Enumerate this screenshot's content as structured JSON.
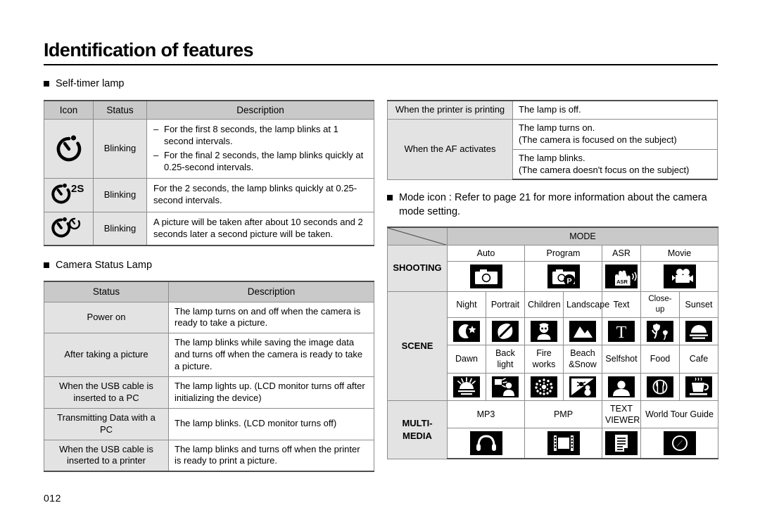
{
  "page": {
    "title": "Identification of features",
    "number": "012"
  },
  "self_timer": {
    "heading": "Self-timer lamp",
    "columns": [
      "Icon",
      "Status",
      "Description"
    ],
    "rows": [
      {
        "icon": "self-timer-10s-icon",
        "status": "Blinking",
        "description_items": [
          "For the first 8 seconds, the lamp blinks at 1 second intervals.",
          "For the final 2 seconds, the lamp blinks quickly at 0.25-second intervals."
        ]
      },
      {
        "icon": "self-timer-2s-icon",
        "icon_sup": "2S",
        "status": "Blinking",
        "description": "For the 2 seconds, the lamp blinks quickly at 0.25-second intervals."
      },
      {
        "icon": "self-timer-double-icon",
        "status": "Blinking",
        "description": "A picture will be taken after about 10 seconds and 2 seconds later a second picture will be taken."
      }
    ]
  },
  "status_lamp": {
    "heading": "Camera Status Lamp",
    "columns": [
      "Status",
      "Description"
    ],
    "rows": [
      {
        "status": "Power on",
        "description": "The lamp turns on and off when the camera is ready to take a picture."
      },
      {
        "status": "After taking a picture",
        "description": "The lamp blinks while saving the image data and turns off when the camera is ready to take a picture."
      },
      {
        "status": "When the USB cable is inserted to a PC",
        "description": "The lamp lights up. (LCD monitor turns off after initializing the device)"
      },
      {
        "status": "Transmitting Data with a PC",
        "description": "The lamp blinks. (LCD monitor turns off)"
      },
      {
        "status": "When the USB cable is inserted to a printer",
        "description": "The lamp blinks and turns off when the printer is ready to print a picture."
      }
    ]
  },
  "printer_af": {
    "rows": [
      {
        "status": "When the printer is printing",
        "descriptions": [
          "The lamp is off."
        ]
      },
      {
        "status": "When the AF activates",
        "descriptions": [
          "The lamp turns on.\n(The camera is focused on the subject)",
          "The lamp blinks.\n(The camera doesn't focus on the subject)"
        ]
      }
    ]
  },
  "mode_note": "Mode icon : Refer to page 21 for more information about the camera mode setting.",
  "mode_table": {
    "header": "MODE",
    "groups": [
      {
        "label": "SHOOTING",
        "rows": [
          {
            "labels": [
              "Auto",
              "Program",
              "ASR",
              "Movie"
            ],
            "icons": [
              "camera-auto-icon",
              "camera-program-icon",
              "asr-hand-icon",
              "movie-camera-icon"
            ]
          }
        ]
      },
      {
        "label": "SCENE",
        "rows": [
          {
            "labels": [
              "Night",
              "Portrait",
              "Children",
              "Landscape",
              "Text",
              "Close-up",
              "Sunset"
            ],
            "icons": [
              "night-moon-star-icon",
              "portrait-face-icon",
              "children-icon",
              "landscape-mountain-icon",
              "text-t-icon",
              "close-up-tulip-icon",
              "sunset-icon"
            ]
          },
          {
            "labels": [
              "Dawn",
              "Back light",
              "Fire works",
              "Beach &Snow",
              "Selfshot",
              "Food",
              "Cafe"
            ],
            "icons": [
              "dawn-icon",
              "backlight-icon",
              "fireworks-icon",
              "beach-snow-icon",
              "selfshot-icon",
              "food-icon",
              "cafe-icon"
            ]
          }
        ]
      },
      {
        "label": "MULTI- MEDIA",
        "rows": [
          {
            "labels": [
              "MP3",
              "PMP",
              "TEXT VIEWER",
              "World Tour Guide"
            ],
            "icons": [
              "mp3-headphone-icon",
              "pmp-filmstrip-icon",
              "text-viewer-document-icon",
              "world-tour-guide-compass-icon"
            ]
          }
        ]
      }
    ]
  },
  "colors": {
    "header_gray": "#c9c9c9",
    "light_gray": "#e3e3e3",
    "border": "#8c8c8c",
    "icon_black": "#000000"
  }
}
